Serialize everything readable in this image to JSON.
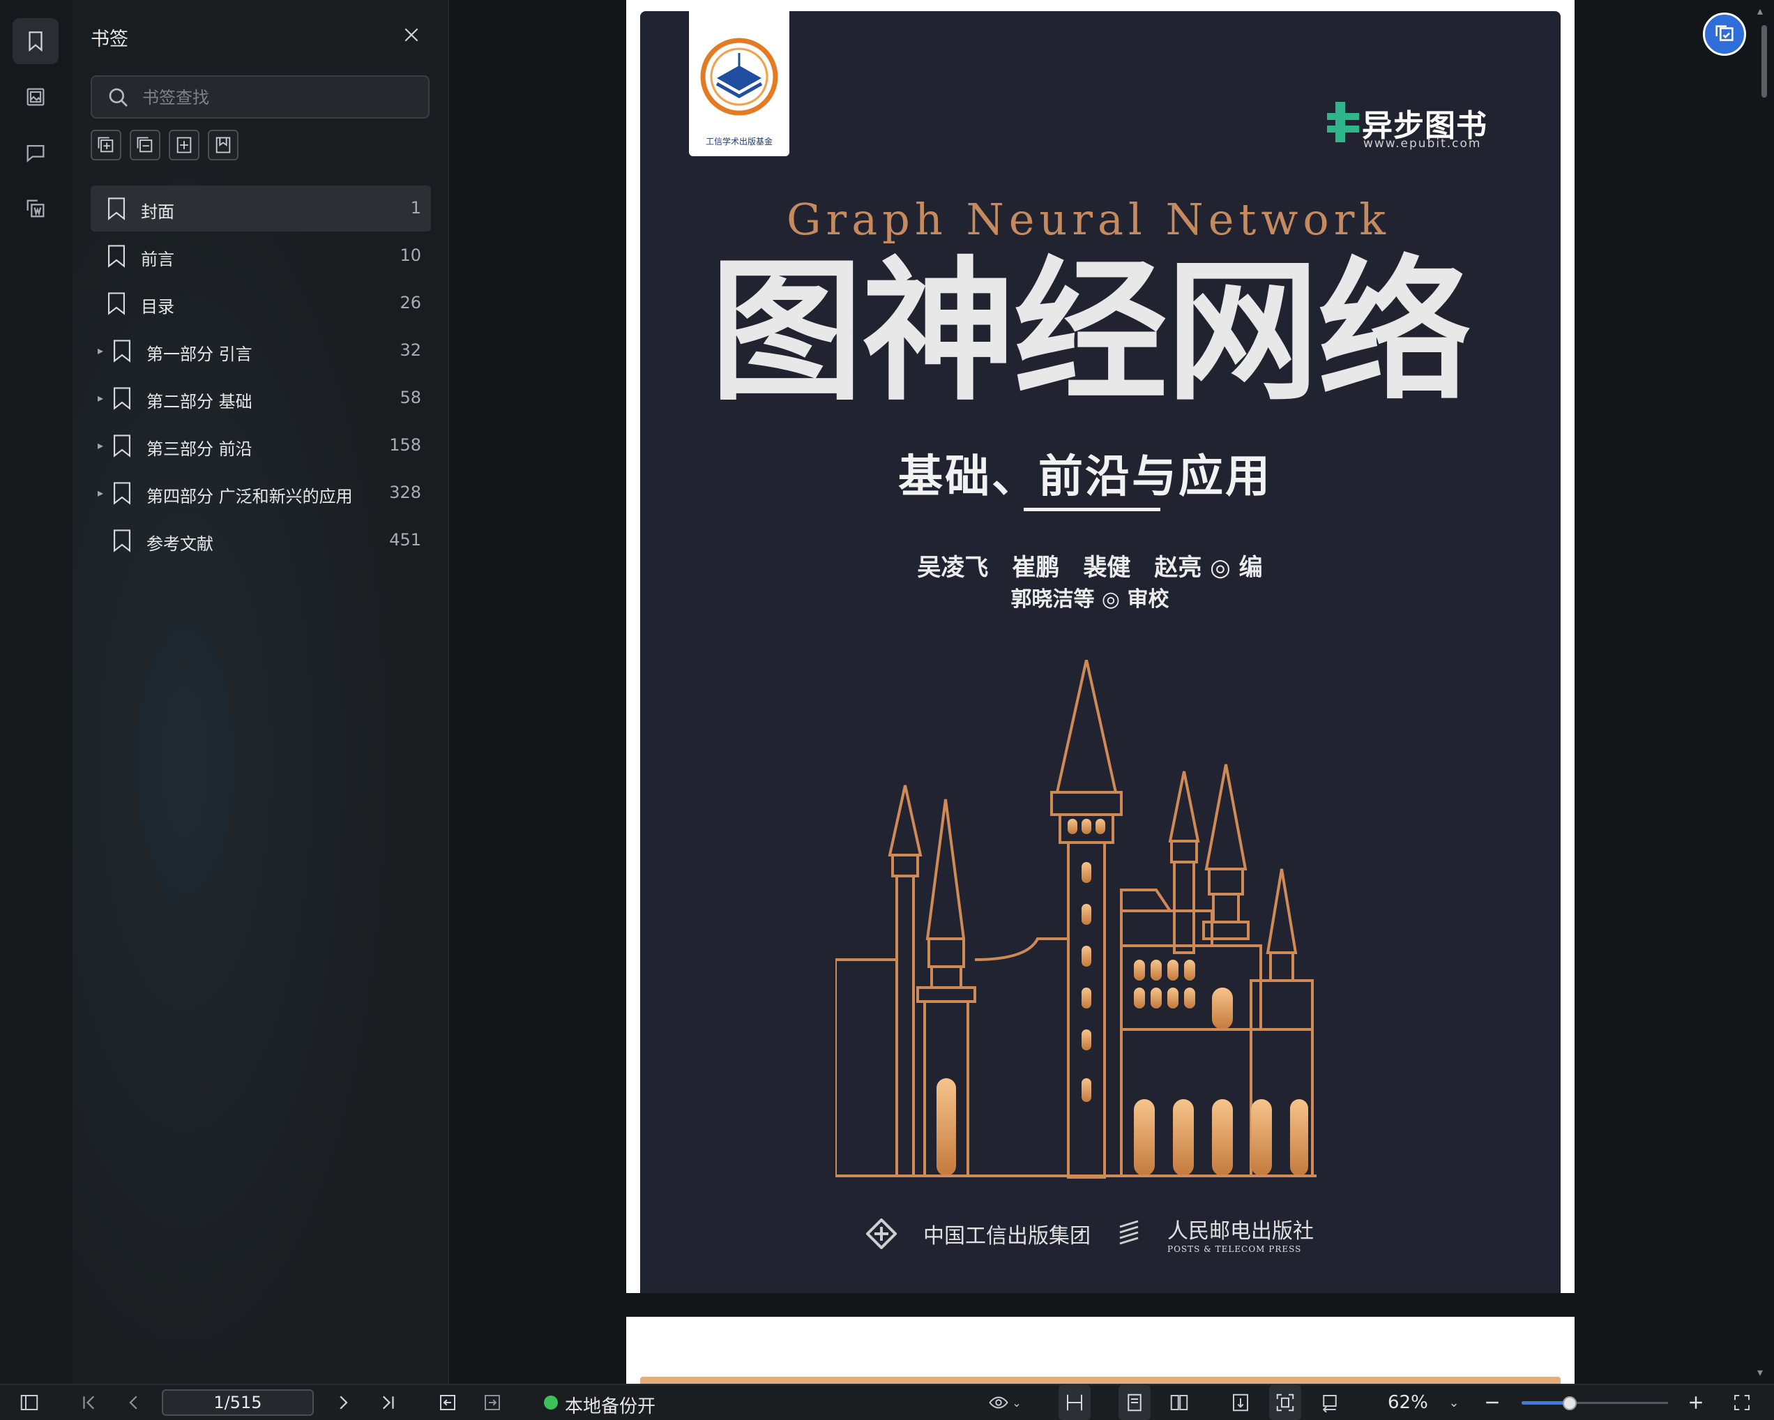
{
  "sidebar_rail": {
    "items": [
      {
        "name": "bookmark",
        "active": true
      },
      {
        "name": "thumbnail"
      },
      {
        "name": "comment"
      },
      {
        "name": "search-in-document"
      }
    ]
  },
  "bookmark_panel": {
    "title": "书签",
    "search_placeholder": "书签查找",
    "items": [
      {
        "label": "封面",
        "page": "1",
        "expandable": false,
        "selected": true
      },
      {
        "label": "前言",
        "page": "10",
        "expandable": false
      },
      {
        "label": "目录",
        "page": "26",
        "expandable": false
      },
      {
        "label": "第一部分 引言",
        "page": "32",
        "expandable": true
      },
      {
        "label": "第二部分 基础",
        "page": "58",
        "expandable": true
      },
      {
        "label": "第三部分 前沿",
        "page": "158",
        "expandable": true
      },
      {
        "label": "第四部分 广泛和新兴的应用",
        "page": "328",
        "expandable": true
      },
      {
        "label": "参考文献",
        "page": "451",
        "expandable": false
      }
    ]
  },
  "cover": {
    "badge_caption": "工信学术出版基金",
    "publisher_name": "异步图书",
    "publisher_url": "www.epubit.com",
    "english_title": "Graph Neural Network",
    "chinese_title": "图神经网络",
    "subtitle": "基础、前沿与应用",
    "authors": "吴凌飞　崔鹏　裴健　赵亮 ◎ 编",
    "reviewers": "郭晓洁等 ◎ 审校",
    "publisher_a": "中国工信出版集团",
    "publisher_b": "人民邮电出版社",
    "publisher_b_en": "POSTS & TELECOM PRESS",
    "accent_color": "#c58a5e",
    "background_color": "#212430"
  },
  "toolbar": {
    "page_indicator": "1/515",
    "backup_status": "本地备份开",
    "zoom": "62%",
    "zoom_slider_fraction": 0.33
  }
}
